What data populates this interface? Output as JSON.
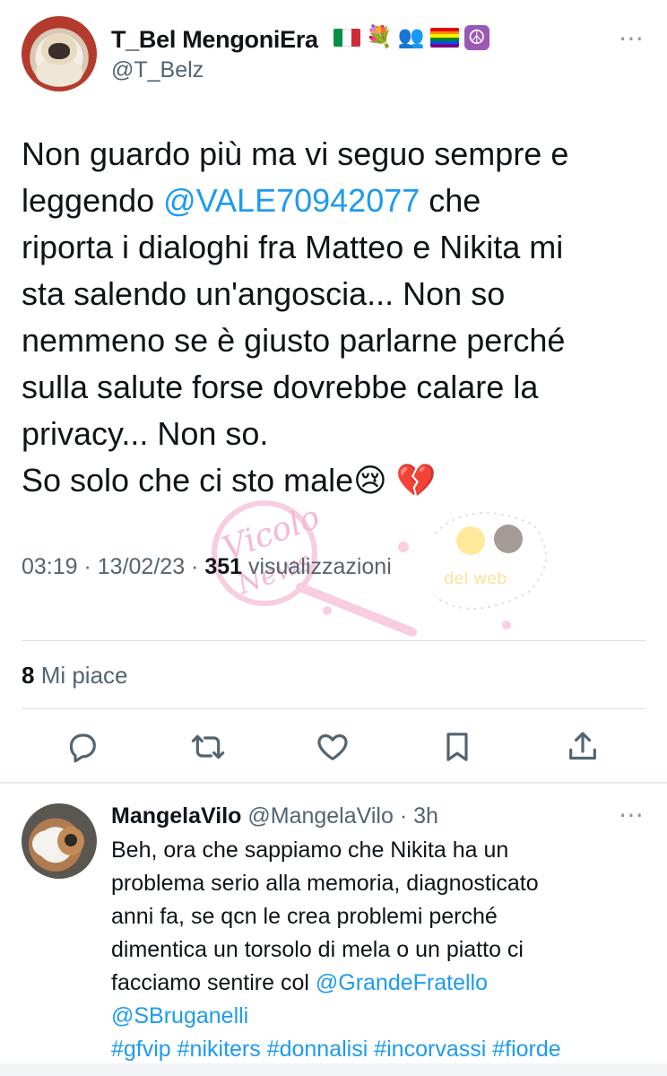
{
  "tweet": {
    "display_name": "T_Bel MengoniEra",
    "handle": "@T_Belz",
    "emojis": [
      "🇮🇹",
      "💐",
      "👥",
      "🏳️‍🌈",
      "☮️"
    ],
    "text_before": "Non guardo più ma vi seguo sempre e\nleggendo ",
    "mention": "@VALE70942077",
    "text_after": " che\nriporta i dialoghi fra Matteo e Nikita mi\nsta salendo un'angoscia... Non so\nnemmeno se è giusto parlarne perché\nsulla salute forse dovrebbe calare la\nprivacy... Non so.\nSo solo che ci sto male😢 💔",
    "timestamp": "03:19 · 13/02/23 · ",
    "views_count": "351",
    "views_label": " visualizzazioni",
    "likes_count": "8",
    "likes_label": " Mi piace",
    "more_icon": "⋯"
  },
  "actions": [
    {
      "name": "reply-icon"
    },
    {
      "name": "retweet-icon"
    },
    {
      "name": "like-icon"
    },
    {
      "name": "bookmark-icon"
    },
    {
      "name": "share-icon"
    }
  ],
  "reply": {
    "display_name": "MangelaVilo",
    "handle_time": " @MangelaVilo · 3h",
    "text": "Beh, ora che sappiamo che Nikita ha un\nproblema serio alla memoria, diagnosticato\nanni fa, se qcn le crea problemi perché\ndimentica un torsolo di mela o un piatto ci\nfacciamo sentire col ",
    "mention1": "@GrandeFratello",
    "mention2": "@SBruganelli",
    "hashtags": "#gfvip #nikiters #donnalisi #incorvassi #fiorde",
    "more_icon": "⋯"
  },
  "watermark": {
    "text_line1": "Vicolo",
    "text_line2": "News",
    "text_right": "del web"
  },
  "colors": {
    "link": "#1d9bf0",
    "secondary_text": "#536471",
    "icon": "#536471"
  }
}
